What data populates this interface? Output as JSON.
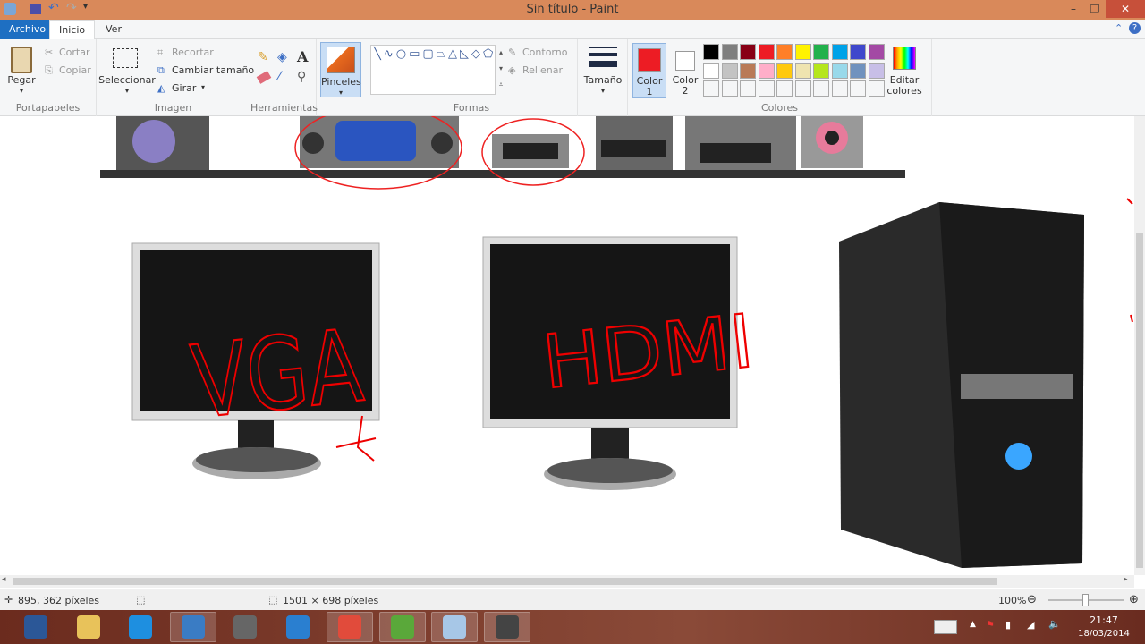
{
  "window": {
    "title": "Sin título - Paint",
    "minimize": "–",
    "maximize": "❐",
    "close": "✕"
  },
  "tabs": [
    {
      "label": "Archivo"
    },
    {
      "label": "Inicio"
    },
    {
      "label": "Ver"
    }
  ],
  "ribbon": {
    "clipboard": {
      "paste": "Pegar",
      "cut": "Cortar",
      "copy": "Copiar",
      "label": "Portapapeles"
    },
    "image": {
      "select": "Seleccionar",
      "crop": "Recortar",
      "resize": "Cambiar tamaño",
      "rotate": "Girar",
      "label": "Imagen"
    },
    "tools": {
      "label": "Herramientas",
      "text_tool": "A"
    },
    "brushes": {
      "label": "Pinceles"
    },
    "shapes": {
      "label": "Formas",
      "outline": "Contorno",
      "fill": "Rellenar"
    },
    "size": {
      "label": "Tamaño"
    },
    "colors": {
      "color1": "Color",
      "color1_num": "1",
      "color2": "Color",
      "color2_num": "2",
      "edit": "Editar",
      "edit2": "colores",
      "label": "Colores",
      "color1_value": "#ed1c24",
      "color2_value": "#ffffff",
      "palette_row1": [
        "#000000",
        "#7f7f7f",
        "#880015",
        "#ed1c24",
        "#ff7f27",
        "#fff200",
        "#22b14c",
        "#00a2e8",
        "#3f48cc",
        "#a349a4"
      ],
      "palette_row2": [
        "#ffffff",
        "#c3c3c3",
        "#b97a57",
        "#ffaec9",
        "#ffc90e",
        "#efe4b0",
        "#b5e61d",
        "#99d9ea",
        "#7092be",
        "#c8bfe7"
      ]
    }
  },
  "canvas": {
    "annotations": [
      "VGA",
      "HDMI"
    ]
  },
  "status": {
    "cursor_pos": "895, 362 píxeles",
    "canvas_size": "1501 × 698 píxeles",
    "zoom": "100%",
    "zoom_level_percent": 100
  },
  "taskbar": {
    "time": "21:47",
    "date": "18/03/2014",
    "apps": [
      "Word",
      "Explorador",
      "Internet Explorer",
      "Panel de control",
      "Equipo",
      "Reproductor",
      "Chrome",
      "uTorrent",
      "Paint",
      "Grabador"
    ]
  }
}
